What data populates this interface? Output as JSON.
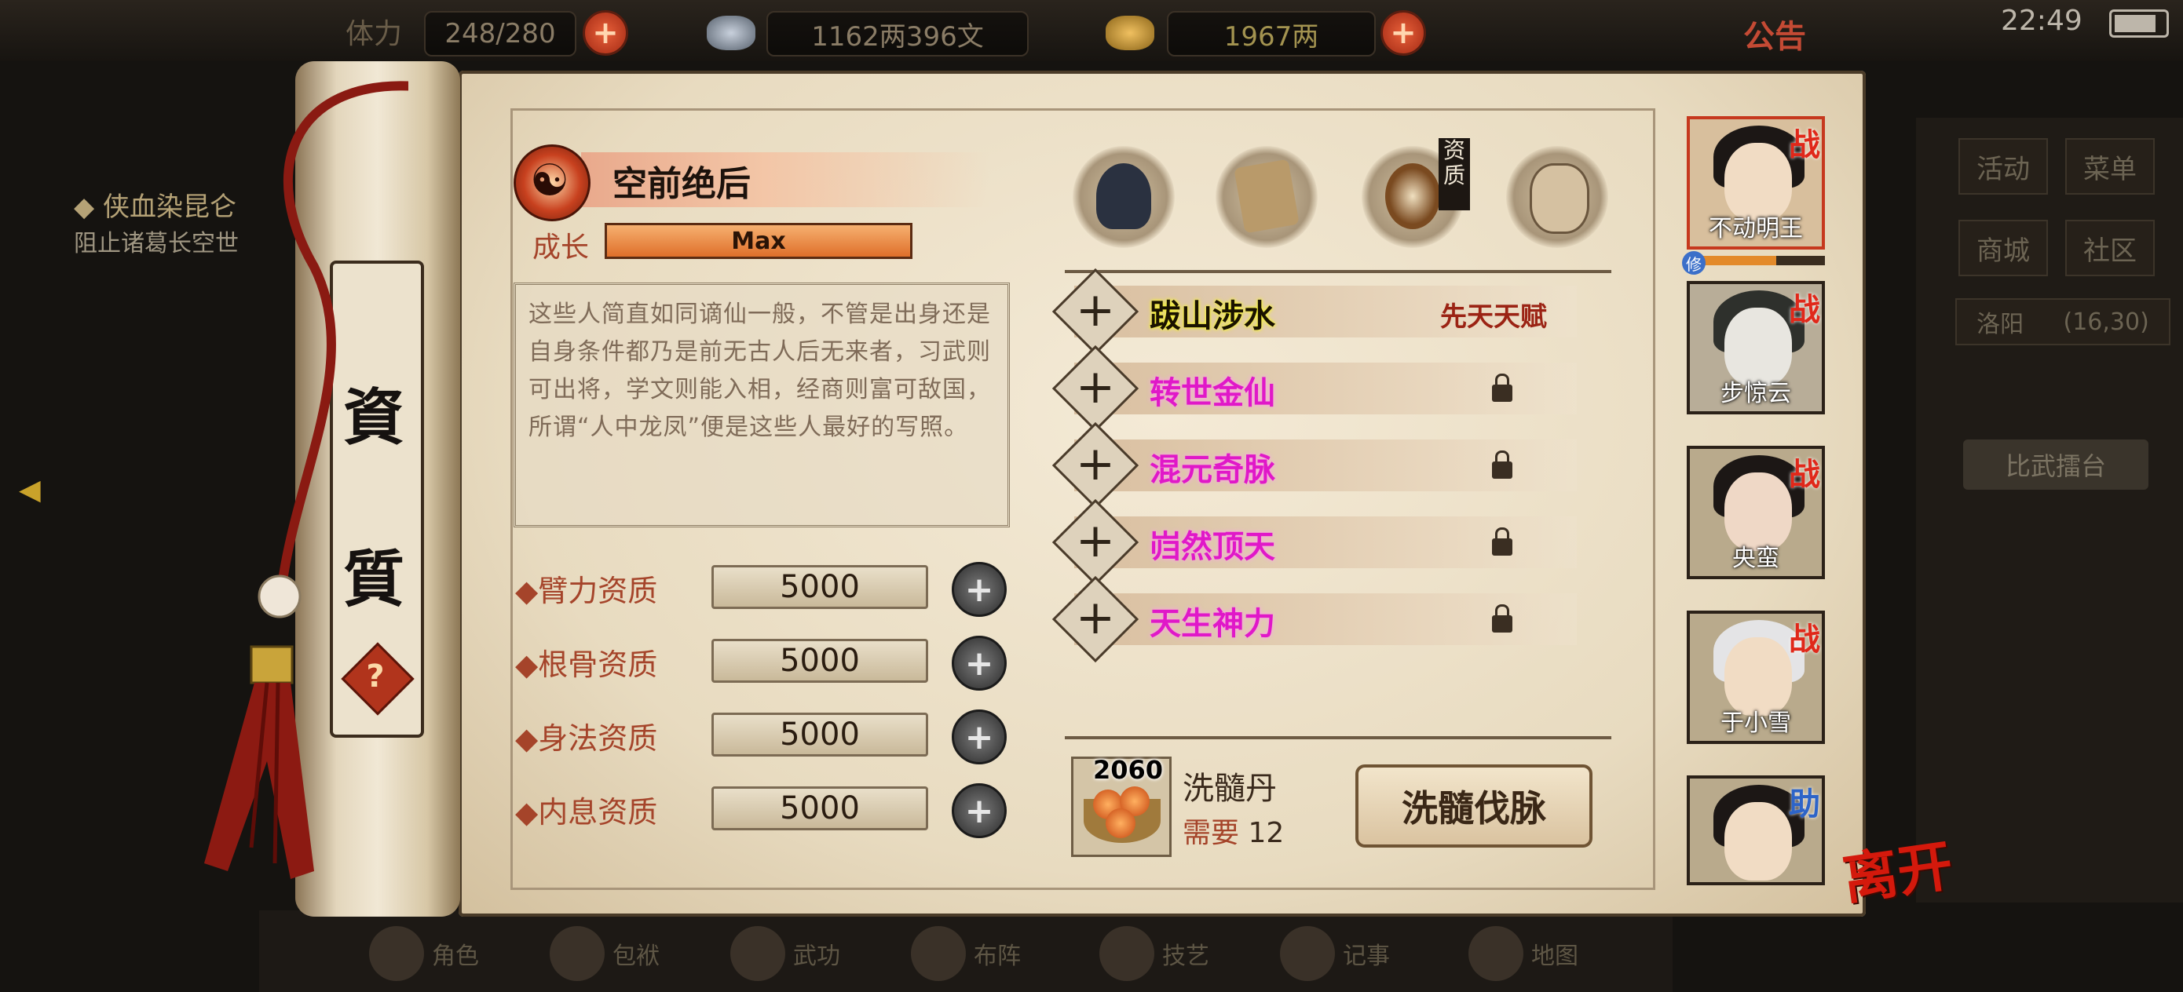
{
  "topbar": {
    "stamina": "248/280",
    "stamina_label": "体力",
    "silver": "1162两396文",
    "gold": "1967两",
    "notice": "公告",
    "time": "22:49"
  },
  "background": {
    "quest_title": "◆ 侠血染昆仑",
    "quest_text": "阻止诸葛长空世",
    "right_buttons": [
      "活动",
      "菜单",
      "商城",
      "社区"
    ],
    "location": "洛阳",
    "location_coords": "(16,30)",
    "arena": "比武擂台",
    "bottom_nav": [
      "角色",
      "包袱",
      "武功",
      "布阵",
      "技艺",
      "记事",
      "地图"
    ]
  },
  "scroll": {
    "roller_chars": [
      "資",
      "質"
    ]
  },
  "trait": {
    "title": "空前绝后",
    "growth_label": "成长",
    "growth_value": "Max",
    "growth_fraction": 1.0,
    "description": "这些人简直如同谪仙一般，不管是出身还是自身条件都乃是前无古人后无来者，习武则可出将，学文则能入相，经商则富可敌国，所谓“人中龙凤”便是这些人最好的写照。"
  },
  "attributes": [
    {
      "label": "◆臂力资质",
      "value": "5000"
    },
    {
      "label": "◆根骨资质",
      "value": "5000"
    },
    {
      "label": "◆身法资质",
      "value": "5000"
    },
    {
      "label": "◆内息资质",
      "value": "5000"
    }
  ],
  "categories": {
    "selected_tag": "资质",
    "icons": [
      "hat-warrior-icon",
      "scroll-book-icon",
      "bagua-icon",
      "muscle-body-icon"
    ]
  },
  "talents": [
    {
      "name": "跋山涉水",
      "color": "#1a1200",
      "highlight": "#f7f52a",
      "tag": "先天天赋",
      "locked": false
    },
    {
      "name": "转世金仙",
      "color": "#e018c8",
      "highlight": "#ff9ff0",
      "tag": "",
      "locked": true
    },
    {
      "name": "混元奇脉",
      "color": "#e018c8",
      "highlight": "#ff9ff0",
      "tag": "",
      "locked": true
    },
    {
      "name": "岿然顶天",
      "color": "#e018c8",
      "highlight": "#ff9ff0",
      "tag": "",
      "locked": true
    },
    {
      "name": "天生神力",
      "color": "#e018c8",
      "highlight": "#ff9ff0",
      "tag": "",
      "locked": true
    }
  ],
  "pill": {
    "count": "2060",
    "name": "洗髓丹",
    "need_label": "需要",
    "need_value": "12",
    "action": "洗髓伐脉"
  },
  "characters": [
    {
      "name": "不动明王",
      "badge": "战",
      "active": true
    },
    {
      "name": "步惊云",
      "badge": "战",
      "active": false
    },
    {
      "name": "央蛮",
      "badge": "战",
      "active": false
    },
    {
      "name": "于小雪",
      "badge": "战",
      "active": false
    },
    {
      "name": "",
      "badge": "助",
      "active": false
    }
  ],
  "xiu_badge": "修",
  "leave": "离开"
}
